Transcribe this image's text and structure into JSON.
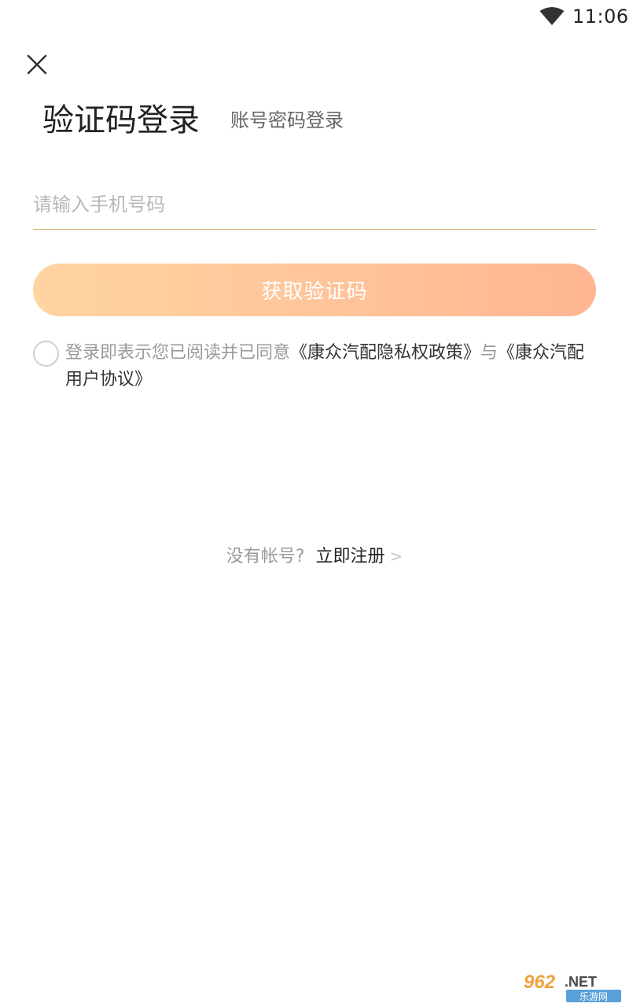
{
  "status_bar": {
    "time": "11:06",
    "wifi_icon": "wifi-icon"
  },
  "header": {
    "close_icon": "close-icon"
  },
  "tabs": [
    {
      "label": "验证码登录",
      "active": true
    },
    {
      "label": "账号密码登录",
      "active": false
    }
  ],
  "phone_input": {
    "value": "",
    "placeholder": "请输入手机号码"
  },
  "get_code_button": {
    "label": "获取验证码"
  },
  "agreement": {
    "checked": false,
    "prefix": "登录即表示您已阅读并已同意",
    "privacy_link": "《康众汽配隐私权政策》",
    "conjunction": "与",
    "user_agreement_link": "《康众汽配用户协议》"
  },
  "register": {
    "prompt": "没有帐号?",
    "link": "立即注册",
    "arrow": ">"
  },
  "watermark": {
    "text": "962.NET",
    "subtext": "乐游网"
  },
  "colors": {
    "button_gradient_start": "#ffd4a0",
    "button_gradient_end": "#ffb592",
    "input_underline": "#d4b270",
    "text_primary": "#222222",
    "text_secondary": "#9a9a9a"
  }
}
